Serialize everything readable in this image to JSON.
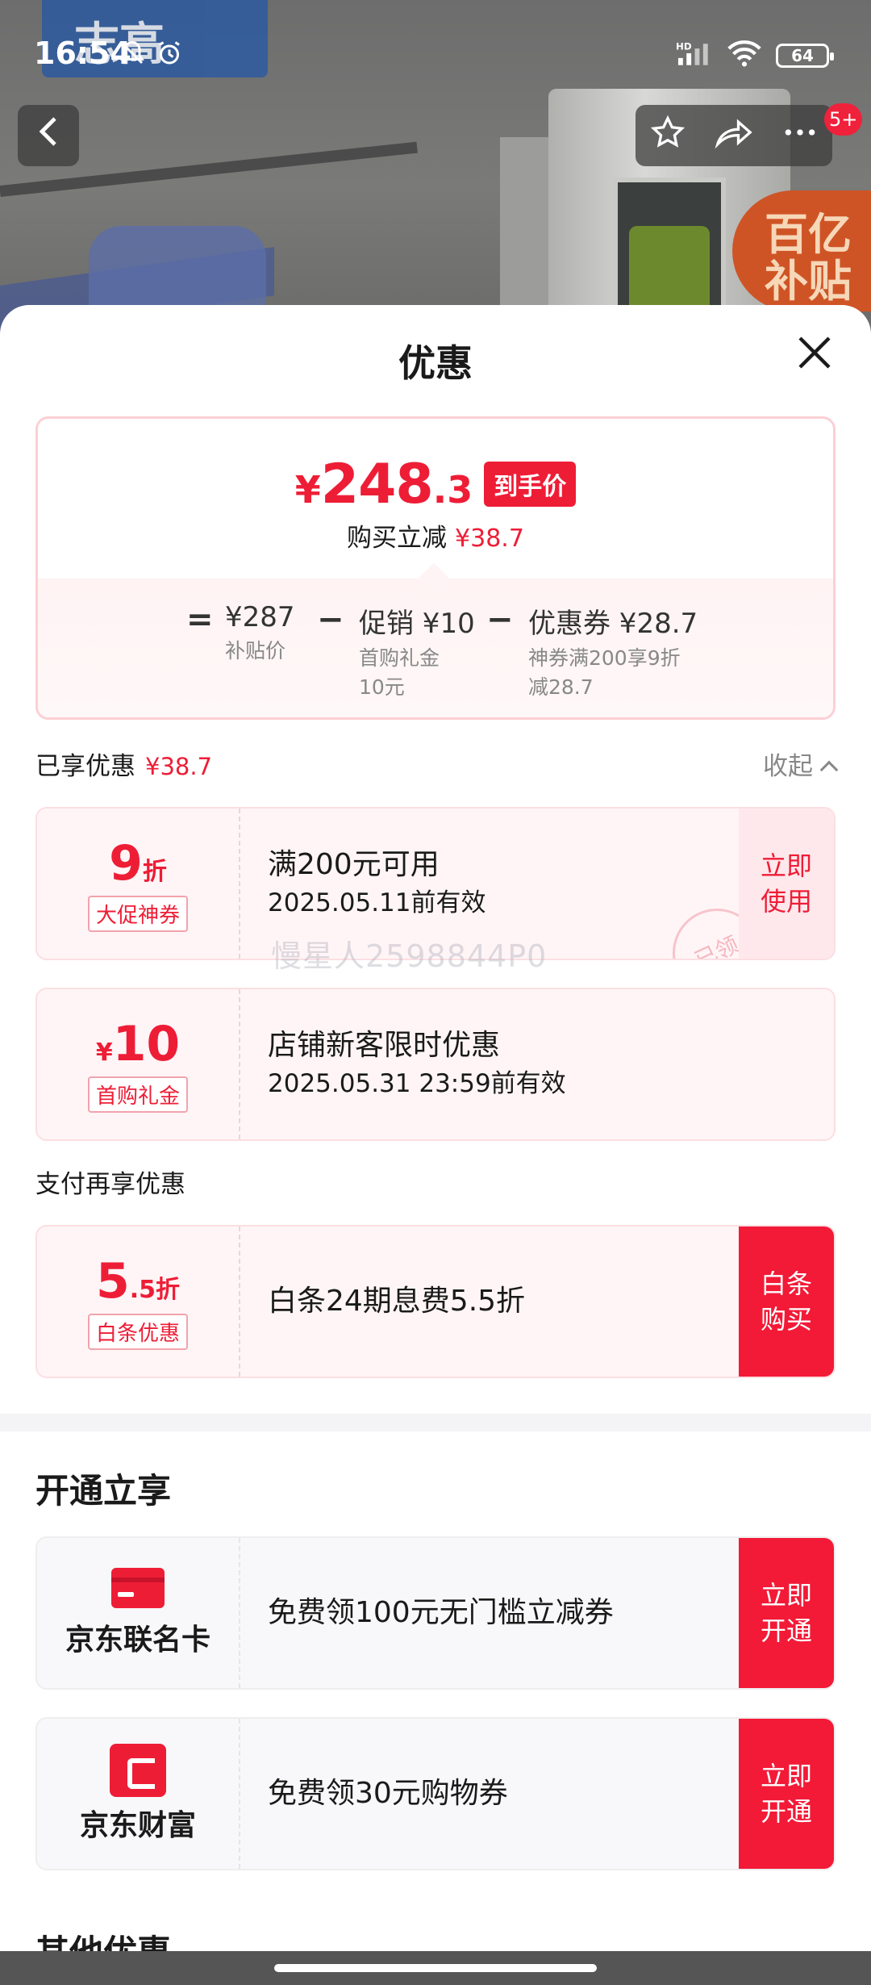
{
  "status_bar": {
    "time": "16:54",
    "battery": "64",
    "network_label": "HD"
  },
  "background": {
    "brand_text": "志高",
    "promo_badge": "百亿补贴",
    "message_count": "5+"
  },
  "sheet": {
    "title": "优惠",
    "summary": {
      "currency": "¥",
      "price_int": "248",
      "price_dec": ".3",
      "price_tag": "到手价",
      "save_label": "购买立减",
      "save_value": "¥38.7",
      "eq": "=",
      "minus": "−",
      "terms": [
        {
          "main": "¥287",
          "sub": "补贴价"
        },
        {
          "main": "促销 ¥10",
          "sub": "首购礼金\n10元"
        },
        {
          "main": "优惠券 ¥28.7",
          "sub": "神券满200享9折\n减28.7"
        }
      ]
    },
    "enjoyed": {
      "label": "已享优惠",
      "value": "¥38.7",
      "collapse": "收起"
    },
    "coupons": [
      {
        "big": "9",
        "small": "折",
        "tag": "大促神券",
        "title": "满200元可用",
        "sub": "2025.05.11前有效",
        "action": "立即\n使用",
        "stamp": "已领"
      },
      {
        "prefix": "¥",
        "big": "10",
        "tag": "首购礼金",
        "title": "店铺新客限时优惠",
        "sub": "2025.05.31 23:59前有效"
      }
    ],
    "watermark": "慢星人2598844P0",
    "pay_section_label": "支付再享优惠",
    "pay_coupon": {
      "big": "5",
      "small": ".5折",
      "tag": "白条优惠",
      "title": "白条24期息费5.5折",
      "action": "白条\n购买"
    },
    "open_section_title": "开通立享",
    "open_items": [
      {
        "brand": "京东联名卡",
        "icon": "card-icon",
        "title": "免费领100元无门槛立减券",
        "action": "立即\n开通"
      },
      {
        "brand": "京东财富",
        "icon": "wealth-icon",
        "title": "免费领30元购物券",
        "action": "立即\n开通"
      }
    ],
    "peek_title": "其他优惠"
  },
  "colors": {
    "accent": "#ee1d36",
    "pink_border": "#fbd0d5"
  }
}
